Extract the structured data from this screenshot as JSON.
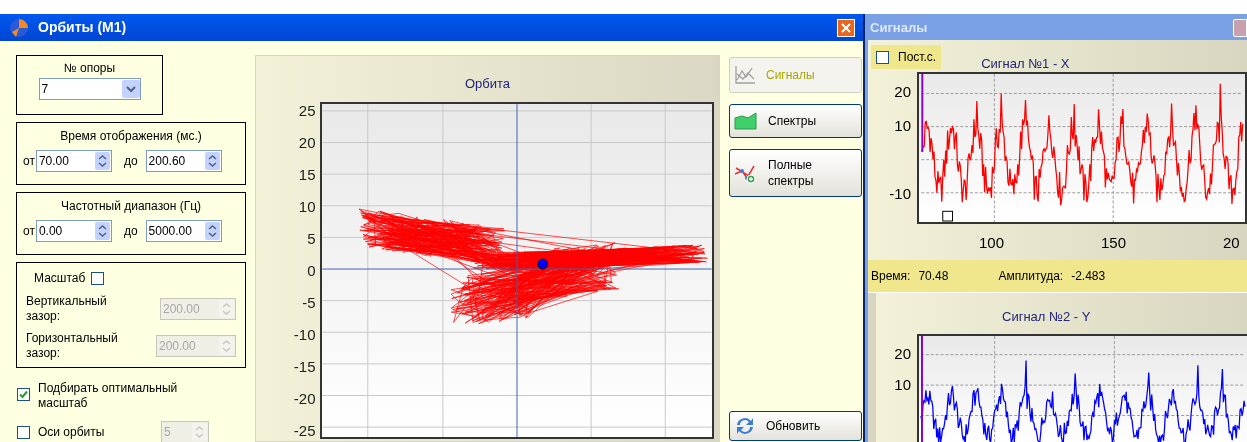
{
  "orbit_window": {
    "title": "Орбиты (М1)",
    "support": {
      "label": "№ опоры",
      "value": "7"
    },
    "time_range": {
      "label": "Время отображения (мс.)",
      "from_label": "от",
      "from": "70.00",
      "to_label": "до",
      "to": "200.60"
    },
    "freq_range": {
      "label": "Частотный диапазон (Гц)",
      "from_label": "от",
      "from": "0.00",
      "to_label": "до",
      "to": "5000.00"
    },
    "scale": {
      "label": "Масштаб",
      "checked": false,
      "vertical_label": "Вертикальный зазор:",
      "vertical": "200.00",
      "horizontal_label": "Горизонтальный зазор:",
      "horizontal": "200.00"
    },
    "options": [
      {
        "label": "Подбирать оптимальный масштаб",
        "checked": true
      },
      {
        "label": "Оси орбиты",
        "checked": false,
        "value": "5"
      }
    ],
    "chart": {
      "title": "Орбита",
      "y_labels": [
        "25",
        "20",
        "15",
        "10",
        "5",
        "0",
        "-5",
        "-10",
        "-15",
        "-20",
        "-25"
      ]
    },
    "buttons": [
      {
        "label": "Сигналы",
        "kind": "signals",
        "disabled": true
      },
      {
        "label": "Спектры",
        "kind": "spectrum",
        "disabled": false
      },
      {
        "label": "Полные спектры",
        "kind": "full",
        "disabled": false
      }
    ],
    "refresh": {
      "label": "Обновить"
    }
  },
  "signals_window": {
    "title": "Сигналы",
    "dc": {
      "label": "Пост.с.",
      "checked": false
    },
    "signals": [
      {
        "title": "Сигнал №1 - X",
        "color": "#ff0000",
        "y_labels": [
          "20",
          "10",
          "-10"
        ],
        "x_labels": [
          "100",
          "150",
          "20"
        ]
      },
      {
        "title": "Сигнал №2 - Y",
        "color": "#0000ff",
        "y_labels": [
          "20",
          "10"
        ]
      }
    ],
    "status": {
      "time_label": "Время:",
      "time": "70.48",
      "amp_label": "Амплитуда:",
      "amp": "-2.483"
    }
  }
}
